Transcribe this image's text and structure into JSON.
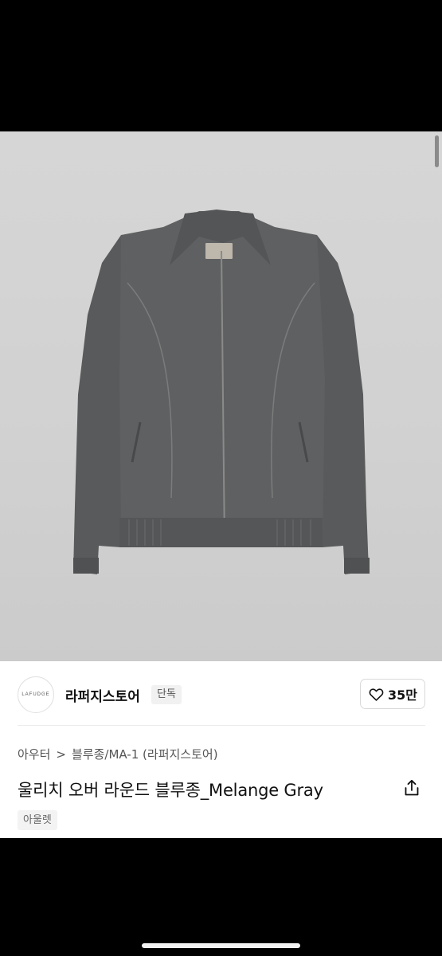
{
  "product_image": {
    "icon": "jacket-image",
    "colors": {
      "backdrop": "#d3d3d3",
      "jacket": "#5f6061"
    }
  },
  "store": {
    "logo_text": "LAFUDGE",
    "name": "라퍼지스토어",
    "badge": "단독"
  },
  "like": {
    "count": "35만",
    "icon": "heart-outline-icon"
  },
  "breadcrumb": {
    "category": "아우터",
    "separator": ">",
    "subcategory": "블루종/MA-1 (라퍼지스토어)"
  },
  "product": {
    "title": "울리치 오버 라운드 블루종_Melange Gray",
    "share_icon": "share-icon"
  },
  "tags": [
    "아울렛"
  ]
}
